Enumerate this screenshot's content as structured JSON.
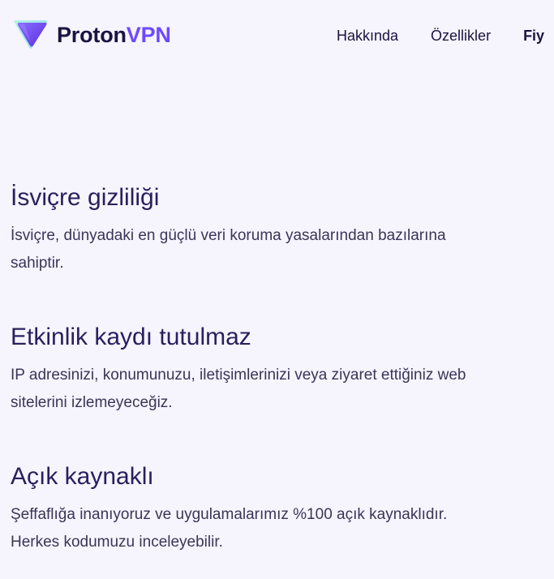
{
  "header": {
    "logo_word_1": "Proton",
    "logo_word_2": "VPN",
    "nav": {
      "about": "Hakkında",
      "features": "Özellikler",
      "pricing_partial": "Fiy"
    }
  },
  "features": [
    {
      "title": "İsviçre gizliliği",
      "description": "İsviçre, dünyadaki en güçlü veri koruma yasalarından bazılarına sahiptir."
    },
    {
      "title": "Etkinlik kaydı tutulmaz",
      "description": "IP adresinizi, konumunuzu, iletişimlerinizi veya ziyaret ettiğiniz web sitelerini izlemeyeceğiz."
    },
    {
      "title": "Açık kaynaklı",
      "description": "Şeffaflığa inanıyoruz ve uygulamalarımız %100 açık kaynaklıdır. Herkes kodumuzu inceleyebilir."
    }
  ],
  "colors": {
    "background": "#f6f4fd",
    "brand_dark": "#1b1340",
    "brand_purple": "#6d4aff",
    "heading": "#2a1f5e",
    "body_text": "#3b3558"
  },
  "icons": {
    "logo": "proton-vpn-triangle-logo-icon"
  }
}
